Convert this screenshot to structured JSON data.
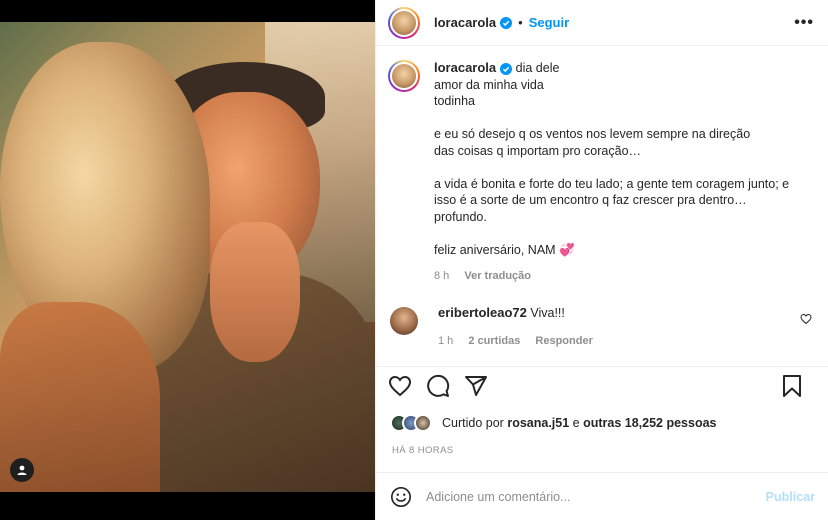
{
  "post": {
    "author": "loracarola",
    "follow_label": "Seguir",
    "more_label": "•••",
    "dot": "•"
  },
  "caption": {
    "author": "loracarola",
    "lines": [
      "dia dele",
      "amor da minha vida",
      "todinha",
      "",
      "e eu só desejo q os ventos nos levem sempre na direção",
      "das coisas q importam pro coração…",
      "",
      "a vida é bonita e forte do teu lado; a gente tem coragem junto; e",
      "isso é a sorte de um encontro q faz crescer pra dentro…",
      "profundo.",
      "",
      "feliz aniversário, NAM 💞"
    ],
    "time": "8 h",
    "see_translation": "Ver tradução"
  },
  "comments": [
    {
      "author": "eribertoleao72",
      "text": "Viva!!!",
      "time": "1 h",
      "likes": "2 curtidas",
      "reply": "Responder"
    }
  ],
  "likes": {
    "prefix": "Curtido por",
    "user": "rosana.j51",
    "middle": "e",
    "others": "outras 18,252 pessoas"
  },
  "time_ago": "HÁ 8 HORAS",
  "comment_box": {
    "placeholder": "Adicione um comentário...",
    "publish": "Publicar"
  },
  "colors": {
    "accent": "#0095f6",
    "publish_disabled": "#b2dffc",
    "muted": "#8e8e8e"
  },
  "icons": [
    "user-tag-icon",
    "verified-icon",
    "more-icon",
    "heart-icon",
    "comment-icon",
    "share-icon",
    "bookmark-icon",
    "emoji-icon"
  ]
}
